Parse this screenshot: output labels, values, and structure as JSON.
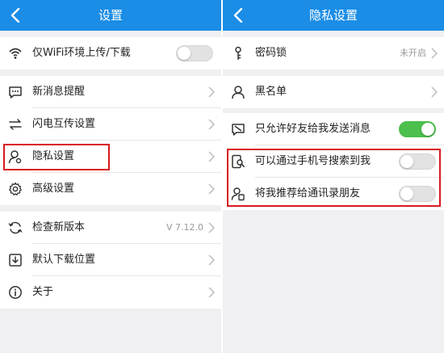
{
  "colors": {
    "header": "#1b8de6",
    "highlight": "#d9191f",
    "toggle_on": "#4cbf4d"
  },
  "left": {
    "title": "设置",
    "wifi_only": {
      "label": "仅WiFi环境上传/下载",
      "enabled": false
    },
    "items": {
      "notify": "新消息提醒",
      "flash": "闪电互传设置",
      "privacy": "隐私设置",
      "advanced": "高级设置",
      "update": "检查新版本",
      "update_version": "V 7.12.0",
      "download": "默认下载位置",
      "about": "关于"
    }
  },
  "right": {
    "title": "隐私设置",
    "lock": {
      "label": "密码锁",
      "status": "未开启"
    },
    "blacklist": "黑名单",
    "friends_only": {
      "label": "只允许好友给我发送消息",
      "enabled": true
    },
    "search_by_phone": {
      "label": "可以通过手机号搜索到我",
      "enabled": false
    },
    "recommend": {
      "label": "将我推荐给通讯录朋友",
      "enabled": false
    }
  }
}
